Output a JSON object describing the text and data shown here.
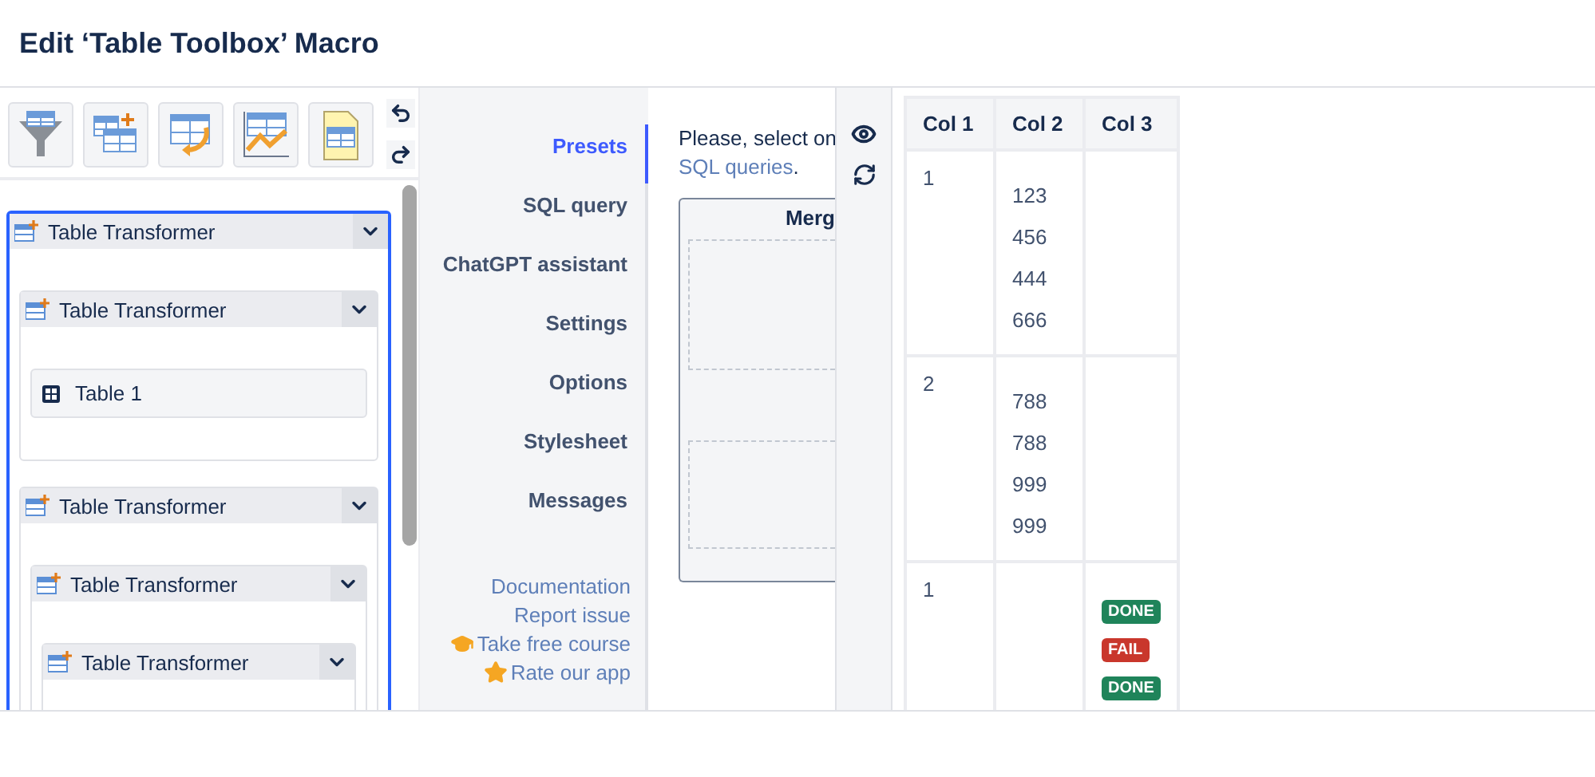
{
  "title": "Edit ‘Table Toolbox’ Macro",
  "tree": [
    {
      "label": "Table Transformer",
      "kind": "transformer",
      "selected": true,
      "children": [
        {
          "label": "Table Transformer",
          "kind": "transformer",
          "children": [
            {
              "label": "Table 1",
              "kind": "table"
            }
          ]
        },
        {
          "label": "Table Transformer",
          "kind": "transformer",
          "children": [
            {
              "label": "Table Transformer",
              "kind": "transformer",
              "children": [
                {
                  "label": "Table Transformer",
                  "kind": "transformer"
                }
              ]
            }
          ]
        }
      ]
    }
  ],
  "nav": [
    {
      "label": "Presets",
      "selected": true
    },
    {
      "label": "SQL query",
      "selected": false
    },
    {
      "label": "ChatGPT assistant",
      "selected": false
    },
    {
      "label": "Settings",
      "selected": false
    },
    {
      "label": "Options",
      "selected": false
    },
    {
      "label": "Stylesheet",
      "selected": false
    },
    {
      "label": "Messages",
      "selected": false
    }
  ],
  "links": [
    {
      "label": "Documentation",
      "kind": "plain"
    },
    {
      "label": "Report issue",
      "kind": "plain"
    },
    {
      "label": "Take free course",
      "kind": "course"
    },
    {
      "label": "Rate our app",
      "kind": "star"
    }
  ],
  "presets": {
    "intro": "Please, select on",
    "link": "SQL queries",
    "suffix": ".",
    "preview_title": "Merg"
  },
  "table": {
    "columns": [
      "Col 1",
      "Col 2",
      "Col 3"
    ],
    "rows": [
      {
        "col1": "1",
        "col2": [
          "123",
          "456",
          "444",
          "666"
        ],
        "col3": []
      },
      {
        "col1": "2",
        "col2": [
          "788",
          "788",
          "999",
          "999"
        ],
        "col3": []
      },
      {
        "col1": "1",
        "col2": [],
        "col3": [
          {
            "label": "DONE",
            "color": "#1f845a"
          },
          {
            "label": "FAIL",
            "color": "#c9372c"
          },
          {
            "label": "DONE",
            "color": "#1f845a"
          }
        ]
      }
    ]
  }
}
